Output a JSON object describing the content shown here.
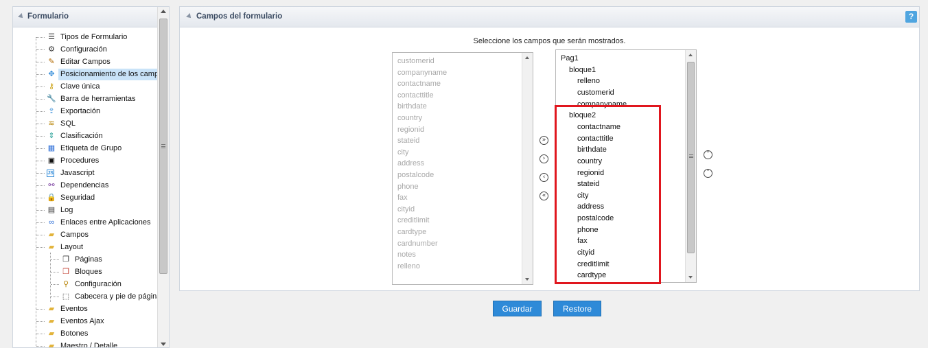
{
  "sidebar": {
    "title": "Formulario",
    "items": [
      {
        "label": "Tipos de Formulario",
        "icon": "list-icon"
      },
      {
        "label": "Configuración",
        "icon": "gear-icon"
      },
      {
        "label": "Editar Campos",
        "icon": "edit-icon"
      },
      {
        "label": "Posicionamiento de los campos",
        "icon": "move-icon",
        "selected": true
      },
      {
        "label": "Clave única",
        "icon": "key-icon"
      },
      {
        "label": "Barra de herramientas",
        "icon": "wrench-icon"
      },
      {
        "label": "Exportación",
        "icon": "export-icon"
      },
      {
        "label": "SQL",
        "icon": "database-icon"
      },
      {
        "label": "Clasificación",
        "icon": "sort-icon"
      },
      {
        "label": "Etiqueta de Grupo",
        "icon": "table-icon"
      },
      {
        "label": "Procedures",
        "icon": "sql-icon"
      },
      {
        "label": "Javascript",
        "icon": "js-icon"
      },
      {
        "label": "Dependencias",
        "icon": "hierarchy-icon"
      },
      {
        "label": "Seguridad",
        "icon": "lock-icon"
      },
      {
        "label": "Log",
        "icon": "log-icon"
      },
      {
        "label": "Enlaces entre Aplicaciones",
        "icon": "link-icon"
      },
      {
        "label": "Campos",
        "icon": "folder-icon"
      },
      {
        "label": "Layout",
        "icon": "folder-icon"
      },
      {
        "label": "Páginas",
        "icon": "pages-icon"
      },
      {
        "label": "Bloques",
        "icon": "blocks-icon"
      },
      {
        "label": "Configuración",
        "icon": "search-icon"
      },
      {
        "label": "Cabecera y pie de página",
        "icon": "header-footer-icon"
      },
      {
        "label": "Eventos",
        "icon": "folder-icon"
      },
      {
        "label": "Eventos Ajax",
        "icon": "folder-icon"
      },
      {
        "label": "Botones",
        "icon": "folder-icon"
      },
      {
        "label": "Maestro / Detalle",
        "icon": "folder-icon"
      }
    ]
  },
  "panel": {
    "title": "Campos del formulario",
    "help_label": "?",
    "instruction": "Seleccione los campos que serán mostrados."
  },
  "available_fields": [
    "customerid",
    "companyname",
    "contactname",
    "contacttitle",
    "birthdate",
    "country",
    "regionid",
    "stateid",
    "city",
    "address",
    "postalcode",
    "phone",
    "fax",
    "cityid",
    "creditlimit",
    "cardtype",
    "cardnumber",
    "notes",
    "relleno"
  ],
  "selected_fields": [
    {
      "label": "Pag1",
      "level": 0
    },
    {
      "label": "bloque1",
      "level": 1
    },
    {
      "label": "relleno",
      "level": 2
    },
    {
      "label": "customerid",
      "level": 2
    },
    {
      "label": "companyname",
      "level": 2
    },
    {
      "label": "bloque2",
      "level": 1
    },
    {
      "label": "contactname",
      "level": 2
    },
    {
      "label": "contacttitle",
      "level": 2
    },
    {
      "label": "birthdate",
      "level": 2
    },
    {
      "label": "country",
      "level": 2
    },
    {
      "label": "regionid",
      "level": 2
    },
    {
      "label": "stateid",
      "level": 2
    },
    {
      "label": "city",
      "level": 2
    },
    {
      "label": "address",
      "level": 2
    },
    {
      "label": "postalcode",
      "level": 2
    },
    {
      "label": "phone",
      "level": 2
    },
    {
      "label": "fax",
      "level": 2
    },
    {
      "label": "cityid",
      "level": 2
    },
    {
      "label": "creditlimit",
      "level": 2
    },
    {
      "label": "cardtype",
      "level": 2
    }
  ],
  "transfer_buttons": {
    "add_all": "»",
    "add": "›",
    "remove": "‹",
    "remove_all": "«"
  },
  "order_buttons": {
    "up": "˄",
    "down": "˅"
  },
  "actions": {
    "save_label": "Guardar",
    "restore_label": "Restore"
  },
  "colors": {
    "accent": "#2e8ad8",
    "highlight": "#e0161e",
    "selected_row": "#c9e3f8"
  }
}
